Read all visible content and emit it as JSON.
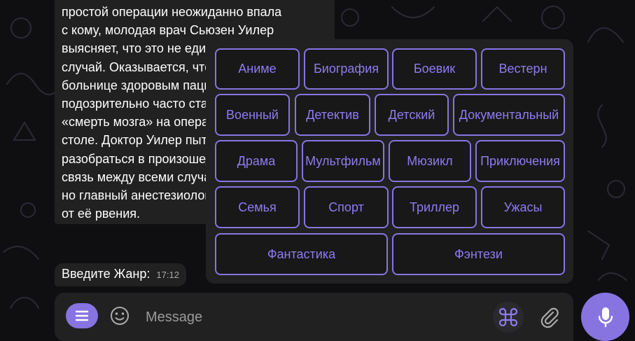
{
  "message": {
    "lines": [
      "простой операции неожиданно впала",
      "с кому, молодая врач Сьюзен Уилер",
      "выясняет, что это не единичный",
      "случай. Оказывается, что в этой",
      "больнице здоровым пациентам",
      "подозрительно часто ставят",
      "«смерть мозга» на операционном",
      "столе. Доктор Уилер пытается",
      "разобраться в произошедшем и найти",
      "связь между всеми случаями,",
      "но главный анестезиолог не в восторге",
      "от её рвения."
    ]
  },
  "prompt": {
    "text": "Введите Жанр:",
    "time": "17:12"
  },
  "keyboard": {
    "rows": [
      [
        "Аниме",
        "Биография",
        "Боевик",
        "Вестерн"
      ],
      [
        "Военный",
        "Детектив",
        "Детский",
        "Документальный"
      ],
      [
        "Драма",
        "Мультфильм",
        "Мюзикл",
        "Приключения"
      ],
      [
        "Семья",
        "Спорт",
        "Триллер",
        "Ужасы"
      ],
      [
        "Фантастика",
        "Фэнтези"
      ]
    ]
  },
  "composer": {
    "placeholder": "Message"
  },
  "icons": [
    "menu-icon",
    "emoji-icon",
    "command-icon",
    "paperclip-icon",
    "microphone-icon"
  ],
  "colors": {
    "background": "#0f0f12",
    "bubble": "#212121",
    "accent": "#8774e1",
    "button_text": "#8e7cf0"
  }
}
